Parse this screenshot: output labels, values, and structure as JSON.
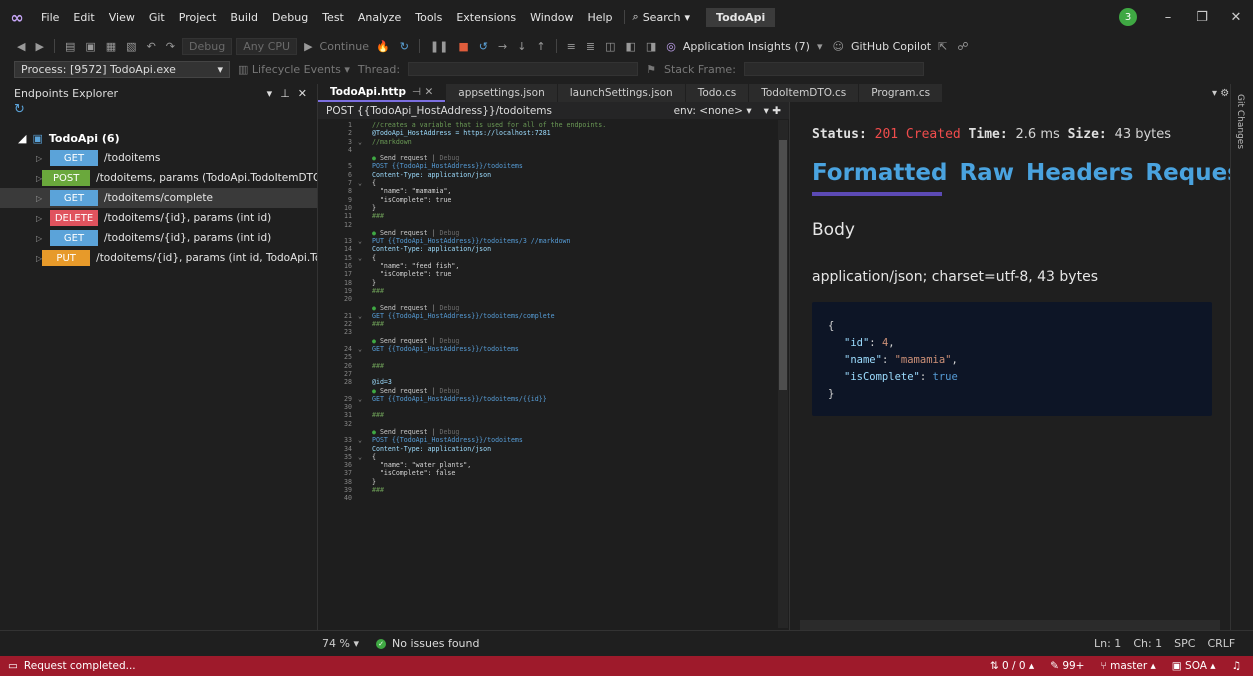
{
  "menubar": {
    "items": [
      "File",
      "Edit",
      "View",
      "Git",
      "Project",
      "Build",
      "Debug",
      "Test",
      "Analyze",
      "Tools",
      "Extensions",
      "Window",
      "Help"
    ],
    "search_label": "Search",
    "solution_name": "TodoApi",
    "avatar_initial": "3"
  },
  "toolbar1": {
    "config": "Debug",
    "platform": "Any CPU",
    "continue_label": "Continue",
    "insights_label": "Application Insights (7)",
    "copilot_label": "GitHub Copilot"
  },
  "toolbar2": {
    "process_label": "Process:",
    "process_value": "[9572] TodoApi.exe",
    "lifecycle_label": "Lifecycle Events",
    "thread_label": "Thread:",
    "stack_label": "Stack Frame:"
  },
  "endpoints": {
    "title": "Endpoints Explorer",
    "root": "TodoApi (6)",
    "items": [
      {
        "method": "GET",
        "path": "/todoitems",
        "color": "#5ba3d9"
      },
      {
        "method": "POST",
        "path": "/todoitems, params (TodoApi.TodoItemDTO todo)",
        "color": "#6aa83c"
      },
      {
        "method": "GET",
        "path": "/todoitems/complete",
        "color": "#5ba3d9"
      },
      {
        "method": "DELETE",
        "path": "/todoitems/{id}, params (int id)",
        "color": "#e0535e"
      },
      {
        "method": "GET",
        "path": "/todoitems/{id}, params (int id)",
        "color": "#5ba3d9"
      },
      {
        "method": "PUT",
        "path": "/todoitems/{id}, params (int id, TodoApi.TodoItem",
        "color": "#e79a2a"
      }
    ]
  },
  "tabs": [
    {
      "label": "TodoApi.http",
      "active": true
    },
    {
      "label": "appsettings.json",
      "active": false
    },
    {
      "label": "launchSettings.json",
      "active": false
    },
    {
      "label": "Todo.cs",
      "active": false
    },
    {
      "label": "TodoItemDTO.cs",
      "active": false
    },
    {
      "label": "Program.cs",
      "active": false
    }
  ],
  "editor": {
    "request_line": "POST {{TodoApi_HostAddress}}/todoitems",
    "env_label": "env: <none>",
    "zoom": "74 %",
    "issues": "No issues found",
    "lens_send": "Send request",
    "lens_debug": "Debug",
    "lines": [
      {
        "n": "1",
        "t": "//creates a variable that is used for all of the endpoints.",
        "c": "c-cmt"
      },
      {
        "n": "2",
        "t": "@TodoApi_HostAddress = https://localhost:7281",
        "c": "c-var"
      },
      {
        "n": "3",
        "t": "//markdown",
        "c": "c-cmt",
        "f": "⌄"
      },
      {
        "n": "4",
        "t": "",
        "c": "cd"
      },
      {
        "n": "",
        "t": "",
        "c": "lens"
      },
      {
        "n": "5",
        "t": "POST {{TodoApi_HostAddress}}/todoitems",
        "c": "c-kw"
      },
      {
        "n": "6",
        "t": "Content-Type: application/json",
        "c": "c-var"
      },
      {
        "n": "7",
        "t": "{",
        "c": "cd",
        "f": "⌄"
      },
      {
        "n": "8",
        "t": "  \"name\": \"mamamia\",",
        "c": "cd"
      },
      {
        "n": "9",
        "t": "  \"isComplete\": true",
        "c": "cd"
      },
      {
        "n": "10",
        "t": "}",
        "c": "cd"
      },
      {
        "n": "11",
        "t": "###",
        "c": "c-cmt"
      },
      {
        "n": "12",
        "t": "",
        "c": "cd"
      },
      {
        "n": "",
        "t": "",
        "c": "lens"
      },
      {
        "n": "13",
        "t": "PUT {{TodoApi_HostAddress}}/todoitems/3 //markdown",
        "c": "c-kw",
        "f": "⌄"
      },
      {
        "n": "14",
        "t": "Content-Type: application/json",
        "c": "c-var"
      },
      {
        "n": "15",
        "t": "{",
        "c": "cd",
        "f": "⌄"
      },
      {
        "n": "16",
        "t": "  \"name\": \"feed fish\",",
        "c": "cd"
      },
      {
        "n": "17",
        "t": "  \"isComplete\": true",
        "c": "cd"
      },
      {
        "n": "18",
        "t": "}",
        "c": "cd"
      },
      {
        "n": "19",
        "t": "###",
        "c": "c-cmt"
      },
      {
        "n": "20",
        "t": "",
        "c": "cd"
      },
      {
        "n": "",
        "t": "",
        "c": "lens"
      },
      {
        "n": "21",
        "t": "GET {{TodoApi_HostAddress}}/todoitems/complete",
        "c": "c-kw",
        "f": "⌄"
      },
      {
        "n": "22",
        "t": "###",
        "c": "c-cmt"
      },
      {
        "n": "23",
        "t": "",
        "c": "cd"
      },
      {
        "n": "",
        "t": "",
        "c": "lens"
      },
      {
        "n": "24",
        "t": "GET {{TodoApi_HostAddress}}/todoitems",
        "c": "c-kw",
        "f": "⌄"
      },
      {
        "n": "25",
        "t": "",
        "c": "cd"
      },
      {
        "n": "26",
        "t": "###",
        "c": "c-cmt"
      },
      {
        "n": "27",
        "t": "",
        "c": "cd"
      },
      {
        "n": "28",
        "t": "@id=3",
        "c": "c-var"
      },
      {
        "n": "",
        "t": "",
        "c": "lens"
      },
      {
        "n": "29",
        "t": "GET {{TodoApi_HostAddress}}/todoitems/{{id}}",
        "c": "c-kw",
        "f": "⌄"
      },
      {
        "n": "30",
        "t": "",
        "c": "cd"
      },
      {
        "n": "31",
        "t": "###",
        "c": "c-cmt"
      },
      {
        "n": "32",
        "t": "",
        "c": "cd"
      },
      {
        "n": "",
        "t": "",
        "c": "lens"
      },
      {
        "n": "33",
        "t": "POST {{TodoApi_HostAddress}}/todoitems",
        "c": "c-kw",
        "f": "⌄"
      },
      {
        "n": "34",
        "t": "Content-Type: application/json",
        "c": "c-var"
      },
      {
        "n": "35",
        "t": "{",
        "c": "cd",
        "f": "⌄"
      },
      {
        "n": "36",
        "t": "  \"name\": \"water plants\",",
        "c": "cd"
      },
      {
        "n": "37",
        "t": "  \"isComplete\": false",
        "c": "cd"
      },
      {
        "n": "38",
        "t": "}",
        "c": "cd"
      },
      {
        "n": "39",
        "t": "###",
        "c": "c-cmt"
      },
      {
        "n": "40",
        "t": "",
        "c": "cd"
      }
    ]
  },
  "response": {
    "status_label": "Status:",
    "status_value": "201 Created",
    "time_label": "Time:",
    "time_value": "2.6 ms",
    "size_label": "Size:",
    "size_value": "43 bytes",
    "tabs": [
      "Formatted",
      "Raw",
      "Headers",
      "Request"
    ],
    "body_title": "Body",
    "content_type": "application/json; charset=utf-8, 43 bytes",
    "json": {
      "open": "{",
      "id_key": "\"id\"",
      "id_val": "4",
      "name_key": "\"name\"",
      "name_val": "\"mamamia\"",
      "complete_key": "\"isComplete\"",
      "complete_val": "true",
      "close": "}"
    }
  },
  "rightedge": {
    "git_changes": "Git Changes"
  },
  "position": {
    "ln": "Ln: 1",
    "ch": "Ch: 1",
    "spc": "SPC",
    "crlf": "CRLF"
  },
  "statusbar": {
    "message": "Request completed...",
    "updown": "0 / 0",
    "pencil": "99+",
    "branch": "master",
    "repo": "SOA"
  }
}
